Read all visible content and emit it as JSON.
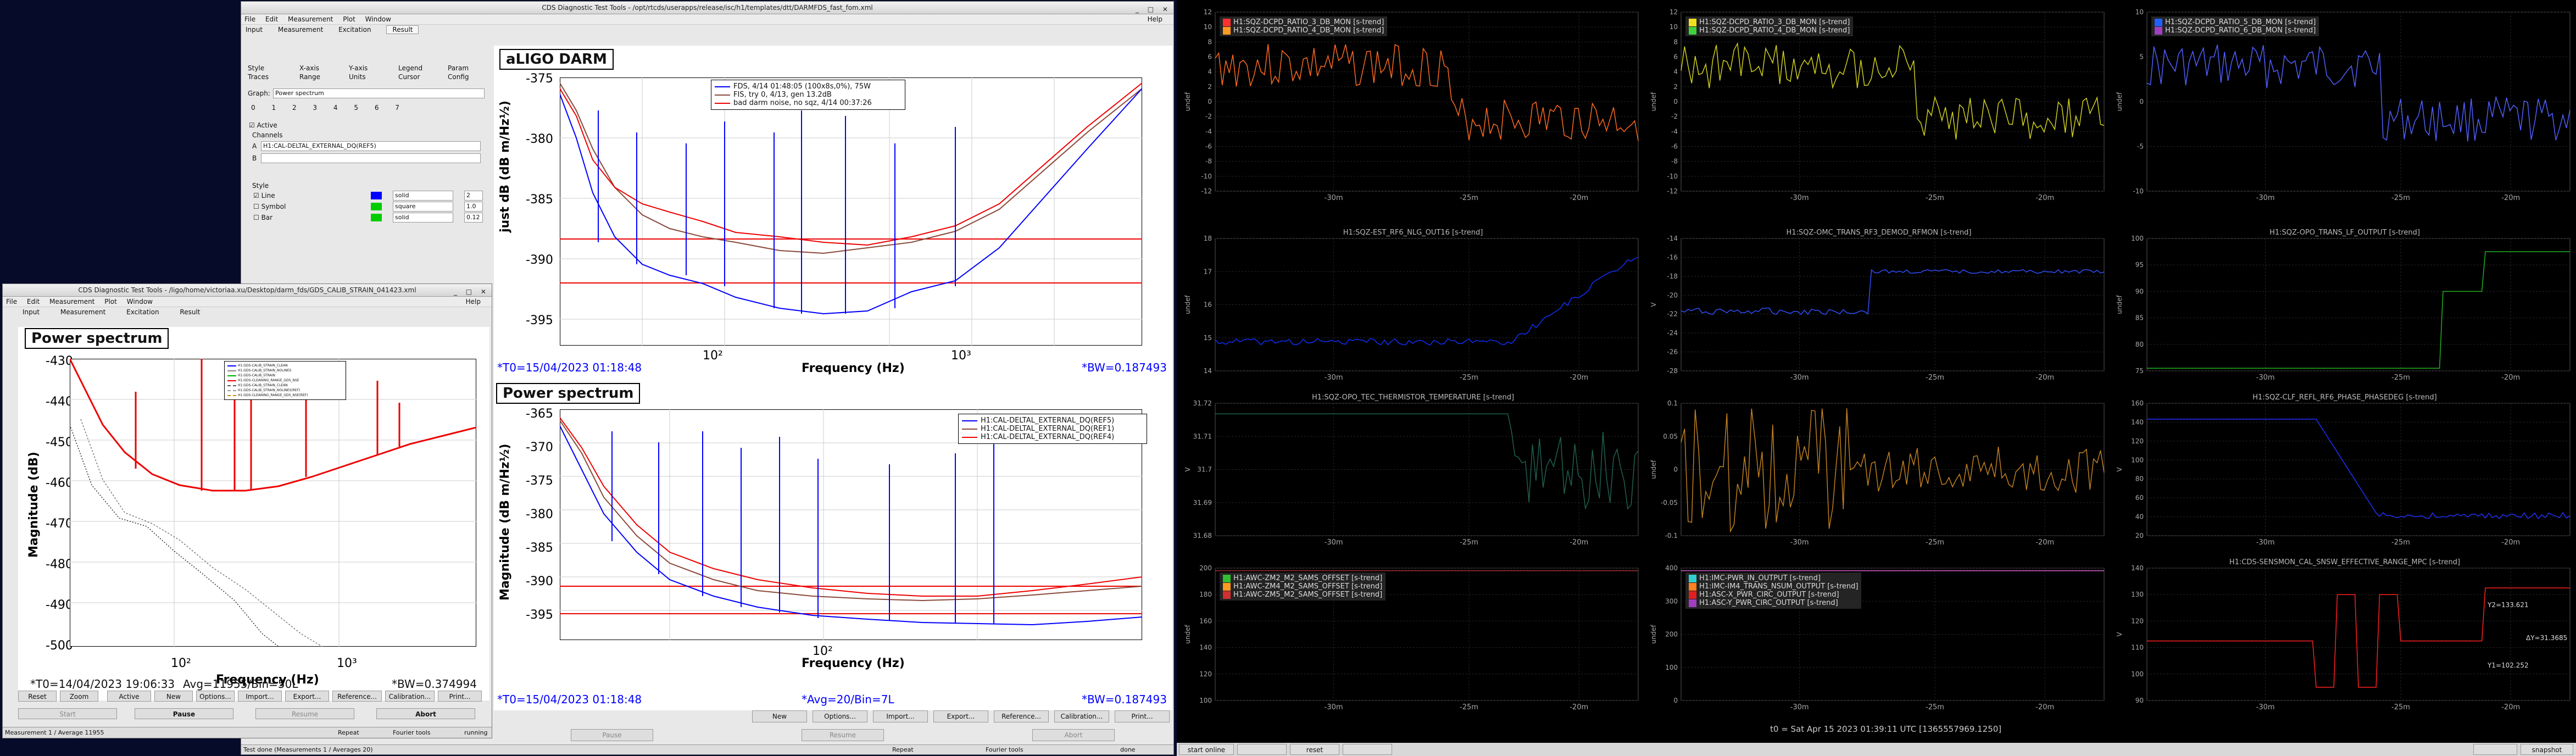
{
  "main_window": {
    "title": "CDS Diagnostic Test Tools - /opt/rtcds/userapps/release/isc/h1/templates/dtt/DARMFDS_fast_fom.xml",
    "menu": [
      "File",
      "Edit",
      "Measurement",
      "Plot",
      "Window"
    ],
    "help": "Help",
    "tabs": [
      "Input",
      "Measurement",
      "Excitation",
      "Result"
    ],
    "subtabs": [
      "Style",
      "X-axis",
      "Y-axis",
      "Legend",
      "Param",
      "Traces",
      "Range",
      "Units",
      "Cursor",
      "Config"
    ],
    "graph_label": "Graph:",
    "graph_value": "Power spectrum",
    "trace_tabs": [
      "0",
      "1",
      "2",
      "3",
      "4",
      "5",
      "6",
      "7"
    ],
    "active_label": "Active",
    "channels_label": "Channels",
    "channel_a": "H1:CAL-DELTAL_EXTERNAL_DQ(REF5)",
    "style_label": "Style",
    "style_rows": [
      {
        "name": "Line",
        "type": "solid",
        "size": "2"
      },
      {
        "name": "Symbol",
        "type": "square",
        "size": "1.0"
      },
      {
        "name": "Bar",
        "type": "solid",
        "size": "0.12"
      }
    ],
    "plot1": {
      "title": "aLIGO DARM",
      "ylabel": "just dB (dB m/Hz½)",
      "xlabel": "Frequency (Hz)",
      "yticks": [
        "-375",
        "-380",
        "-385",
        "-390",
        "-395"
      ],
      "xticks": [
        "10²",
        "10³"
      ],
      "legend": [
        "FDS, 4/14 01:48:05 (100x8s,0%), 75W",
        "FIS, try 0, 4/13, gen 13.2dB",
        "bad darm noise, no sqz, 4/14 00:37:26"
      ],
      "t0": "*T0=15/04/2023 01:18:48",
      "bw": "*BW=0.187493"
    },
    "plot2": {
      "title": "Power spectrum",
      "ylabel": "Magnitude (dB m/Hz½)",
      "xlabel": "Frequency (Hz)",
      "yticks": [
        "-365",
        "-370",
        "-375",
        "-380",
        "-385",
        "-390",
        "-395"
      ],
      "xticks": [
        "10²"
      ],
      "legend": [
        "H1:CAL-DELTAL_EXTERNAL_DQ(REF5)",
        "H1:CAL-DELTAL_EXTERNAL_DQ(REF1)",
        "H1:CAL-DELTAL_EXTERNAL_DQ(REF4)"
      ],
      "t0": "*T0=15/04/2023 01:18:48",
      "avg": "*Avg=20/Bin=7L",
      "bw": "*BW=0.187493"
    },
    "bottom_buttons": [
      "New",
      "Options...",
      "Import...",
      "Export...",
      "Reference...",
      "Calibration...",
      "Print..."
    ],
    "control_buttons": [
      "Pause",
      "Resume",
      "Abort"
    ],
    "status": [
      "Test done (Measurements 1 / Averages 20)",
      "Repeat",
      "Fourier tools",
      "done"
    ]
  },
  "second_window": {
    "title": "CDS Diagnostic Test Tools - /ligo/home/victoriaa.xu/Desktop/darm_fds/GDS_CALIB_STRAIN_041423.xml",
    "menu": [
      "File",
      "Edit",
      "Measurement",
      "Plot",
      "Window"
    ],
    "help": "Help",
    "tabs": [
      "Input",
      "Measurement",
      "Excitation",
      "Result"
    ],
    "plot_title": "Power spectrum",
    "ylabel": "Magnitude (dB)",
    "xlabel": "Frequency (Hz)",
    "yticks": [
      "-430",
      "-440",
      "-450",
      "-460",
      "-470",
      "-480",
      "-490",
      "-500"
    ],
    "xticks": [
      "10²",
      "10³"
    ],
    "legend": [
      "H1:GDS-CALIB_STRAIN_CLEAN",
      "H1:GDS-CALIB_STRAIN_NOLINES",
      "H1:GDS-CALIB_STRAIN",
      "H1:GDS-CLEANING_RANGE_GDS_NSE",
      "H1:GDS-CALIB_STRAIN_CLEAN",
      "H1:GDS-CALIB_STRAIN_NOLINES(REF)",
      "H1:GDS-CLEANING_RANGE_GDS_NSE(REF)"
    ],
    "t0": "*T0=14/04/2023 19:06:33",
    "avg": "Avg=11955/Bin=50L",
    "bw": "*BW=0.374994",
    "bottom_buttons": [
      "Reset",
      "Zoom",
      "Active",
      "New",
      "Options...",
      "Import...",
      "Export...",
      "Reference...",
      "Calibration...",
      "Print..."
    ],
    "control_buttons": [
      "Start",
      "Pause",
      "Resume",
      "Abort"
    ],
    "status": [
      "Measurement 1 / Average 11955",
      "Repeat",
      "Fourier tools",
      "running"
    ]
  },
  "ndscope": {
    "footer_time": "t0 = Sat Apr 15 2023 01:39:11 UTC [1365557969.1250]",
    "footer_buttons": [
      "start online",
      "",
      "reset",
      "",
      "",
      "snapshot"
    ],
    "xticks": [
      "-30m",
      "-25m",
      "-20m"
    ],
    "panels": [
      {
        "title": "",
        "legend": [
          "H1:SQZ-DCPD_RATIO_3_DB_MON [s-trend]",
          "H1:SQZ-DCPD_RATIO_4_DB_MON [s-trend]"
        ],
        "ylabel": "undef",
        "yticks": [
          "12",
          "10",
          "8",
          "6",
          "4",
          "2",
          "0",
          "-2",
          "-4",
          "-6",
          "-8",
          "-10",
          "-12"
        ]
      },
      {
        "title": "",
        "legend": [
          "H1:SQZ-DCPD_RATIO_3_DB_MON [s-trend]",
          "H1:SQZ-DCPD_RATIO_4_DB_MON [s-trend]"
        ],
        "ylabel": "undef",
        "yticks": [
          "12",
          "10",
          "8",
          "6",
          "4",
          "2",
          "0",
          "-2",
          "-4",
          "-6",
          "-8",
          "-10",
          "-12"
        ]
      },
      {
        "title": "",
        "legend": [
          "H1:SQZ-DCPD_RATIO_5_DB_MON [s-trend]",
          "H1:SQZ-DCPD_RATIO_6_DB_MON [s-trend]"
        ],
        "ylabel": "undef",
        "yticks": [
          "10",
          "5",
          "0",
          "-5",
          "-10"
        ]
      },
      {
        "title": "H1:SQZ-EST_RF6_NLG_OUT16 [s-trend]",
        "legend": [],
        "ylabel": "undef",
        "yticks": [
          "18",
          "17",
          "16",
          "15",
          "14"
        ]
      },
      {
        "title": "H1:SQZ-OMC_TRANS_RF3_DEMOD_RFMON [s-trend]",
        "legend": [],
        "ylabel": "V",
        "yticks": [
          "-14",
          "-16",
          "-18",
          "-20",
          "-22",
          "-24",
          "-26",
          "-28"
        ]
      },
      {
        "title": "H1:SQZ-OPO_TRANS_LF_OUTPUT [s-trend]",
        "legend": [],
        "ylabel": "undef",
        "yticks": [
          "100",
          "95",
          "90",
          "85",
          "80",
          "75"
        ]
      },
      {
        "title": "H1:SQZ-OPO_TEC_THERMISTOR_TEMPERATURE [s-trend]",
        "legend": [],
        "ylabel": "V",
        "yticks": [
          "31.72",
          "31.71",
          "31.7",
          "31.69",
          "31.68"
        ]
      },
      {
        "title": "",
        "legend": [],
        "ylabel": "undef",
        "yticks": [
          "0.1",
          "0.05",
          "0",
          "-0.05",
          "-0.1"
        ]
      },
      {
        "title": "H1:SQZ-CLF_REFL_RF6_PHASE_PHASEDEG [s-trend]",
        "legend": [],
        "ylabel": "V",
        "yticks": [
          "160",
          "140",
          "120",
          "100",
          "80",
          "60",
          "40",
          "20"
        ]
      },
      {
        "title": "",
        "legend": [
          "H1:AWC-ZM2_M2_SAMS_OFFSET [s-trend]",
          "H1:AWC-ZM4_M2_SAMS_OFFSET [s-trend]",
          "H1:AWC-ZM5_M2_SAMS_OFFSET [s-trend]"
        ],
        "ylabel": "undef",
        "yticks": [
          "200",
          "180",
          "160",
          "140",
          "120",
          "100"
        ]
      },
      {
        "title": "",
        "legend": [
          "H1:IMC-PWR_IN_OUTPUT [s-trend]",
          "H1:IMC-IM4_TRANS_NSUM_OUTPUT [s-trend]",
          "H1:ASC-X_PWR_CIRC_OUTPUT [s-trend]",
          "H1:ASC-Y_PWR_CIRC_OUTPUT [s-trend]"
        ],
        "ylabel": "undef",
        "yticks": [
          "400",
          "300",
          "200",
          "100",
          "0"
        ]
      },
      {
        "title": "H1:CDS-SENSMON_CAL_SNSW_EFFECTIVE_RANGE_MPC [s-trend]",
        "legend": [],
        "ylabel": "V",
        "yticks": [
          "140",
          "130",
          "120",
          "110",
          "100",
          "90"
        ],
        "annotations": [
          "Y2=133.621",
          "ΔY=31.3685",
          "Y1=102.252"
        ]
      }
    ],
    "colors": {
      "orange": "#ff7a1a",
      "red": "#ff2020",
      "yellow": "#f0e020",
      "green": "#40d040",
      "blue": "#2040ff",
      "purple": "#a040c0",
      "cyan": "#30d0d0",
      "grid": "#2a2a2a"
    }
  }
}
